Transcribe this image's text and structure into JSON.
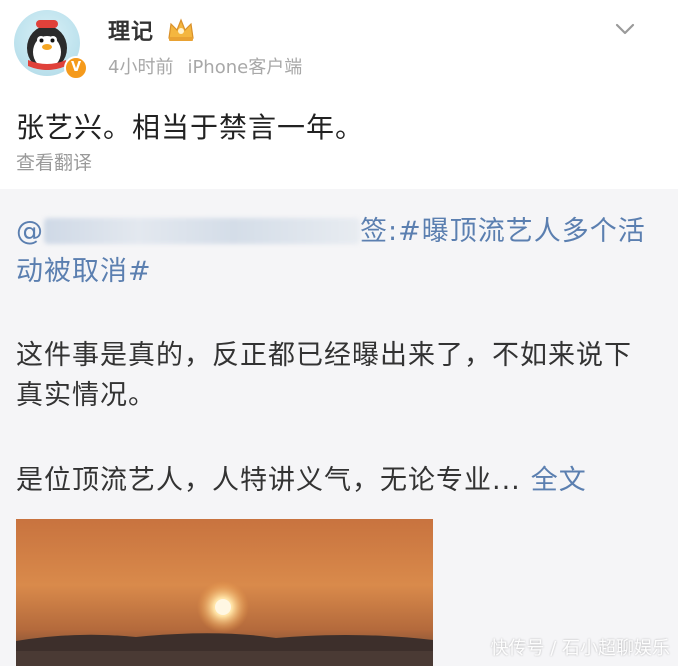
{
  "post": {
    "username": "理记",
    "time": "4小时前",
    "source": "iPhone客户端",
    "text": "张艺兴。相当于禁言一年。",
    "translate_label": "查看翻译"
  },
  "repost": {
    "mention_prefix": "@",
    "mention_suffix": "签:",
    "hashtag_part1": "#曝顶流艺人多个活",
    "hashtag_part2": "动被取消#",
    "paragraph2": "这件事是真的，反正都已经曝出来了，不如来说下真实情况。",
    "paragraph3": "是位顶流艺人，人特讲义气，无论专业...",
    "full_text_label": "全文"
  },
  "watermark": "快传号 / 石小超聊娱乐",
  "colors": {
    "link": "#5b7fb0",
    "badge": "#f59a1b",
    "card_bg": "#ffffff",
    "repost_bg": "#f5f5f7"
  }
}
